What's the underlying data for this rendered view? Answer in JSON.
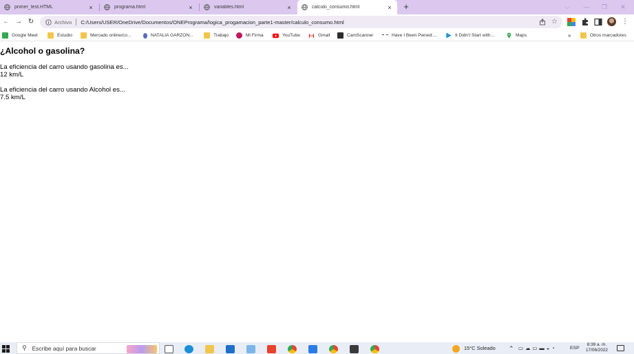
{
  "browser": {
    "tabs": [
      {
        "title": "primer_test.HTML",
        "close": "×",
        "active": false
      },
      {
        "title": "programa.html",
        "close": "×",
        "active": false
      },
      {
        "title": "variables.html",
        "close": "×",
        "active": false
      },
      {
        "title": "calculo_consumo.html",
        "close": "×",
        "active": true
      }
    ],
    "new_tab": "+",
    "window_controls": {
      "tabsearch": "⌵",
      "minimize": "—",
      "restore": "❐",
      "close": "✕"
    },
    "nav": {
      "back": "←",
      "forward": "→",
      "reload": "↻"
    },
    "omnibox": {
      "scheme_label": "Archivo",
      "url": "C:/Users/USER/OneDrive/Documentos/ONEPrograma/logica_progamacion_parte1-master/calculo_consumo.html",
      "star": "☆"
    },
    "menu": "⋮",
    "bookmarks": [
      {
        "label": "Google Meet",
        "icon": "meet-icon",
        "color": "#34a853"
      },
      {
        "label": "Estudio",
        "icon": "folder-icon",
        "color": "#f2c64c"
      },
      {
        "label": "Mercado online/co...",
        "icon": "folder-icon",
        "color": "#f2c64c"
      },
      {
        "label": "NATALIA GARZON...",
        "icon": "trophy-icon",
        "color": "#5b6abf"
      },
      {
        "label": "Trabajo",
        "icon": "folder-icon",
        "color": "#f2c64c"
      },
      {
        "label": "Mi Firma",
        "icon": "signature-icon",
        "color": "#c2185b"
      },
      {
        "label": "YouTube",
        "icon": "youtube-icon",
        "color": "#ff0000"
      },
      {
        "label": "Gmail",
        "icon": "gmail-icon",
        "color": "#d93025"
      },
      {
        "label": "CamScanner",
        "icon": "camscanner-icon",
        "color": "#2b2b2b"
      },
      {
        "label": "Have I Been Pwned:...",
        "icon": "pwned-icon",
        "color": "#444444"
      },
      {
        "label": "It Didn't Start with...",
        "icon": "play-icon",
        "color": "#1a8fd6"
      },
      {
        "label": "Maps",
        "icon": "maps-icon",
        "color": "#34a853"
      }
    ],
    "bookmarks_overflow": "»",
    "other_bookmarks": "Otros marcadores"
  },
  "page": {
    "heading": "¿Alcohol o gasolina?",
    "gas_label": "La eficiencia del carro usando gasolina es...",
    "gas_value": "12 km/L",
    "alcohol_label": "La eficiencia del carro usando Alcohol es...",
    "alcohol_value": "7.5 km/L"
  },
  "taskbar": {
    "search_placeholder": "Escribe aquí para buscar",
    "weather": "15°C  Soleado",
    "language": "ESP",
    "time": "8:39 a. m.",
    "date": "17/06/2022"
  }
}
